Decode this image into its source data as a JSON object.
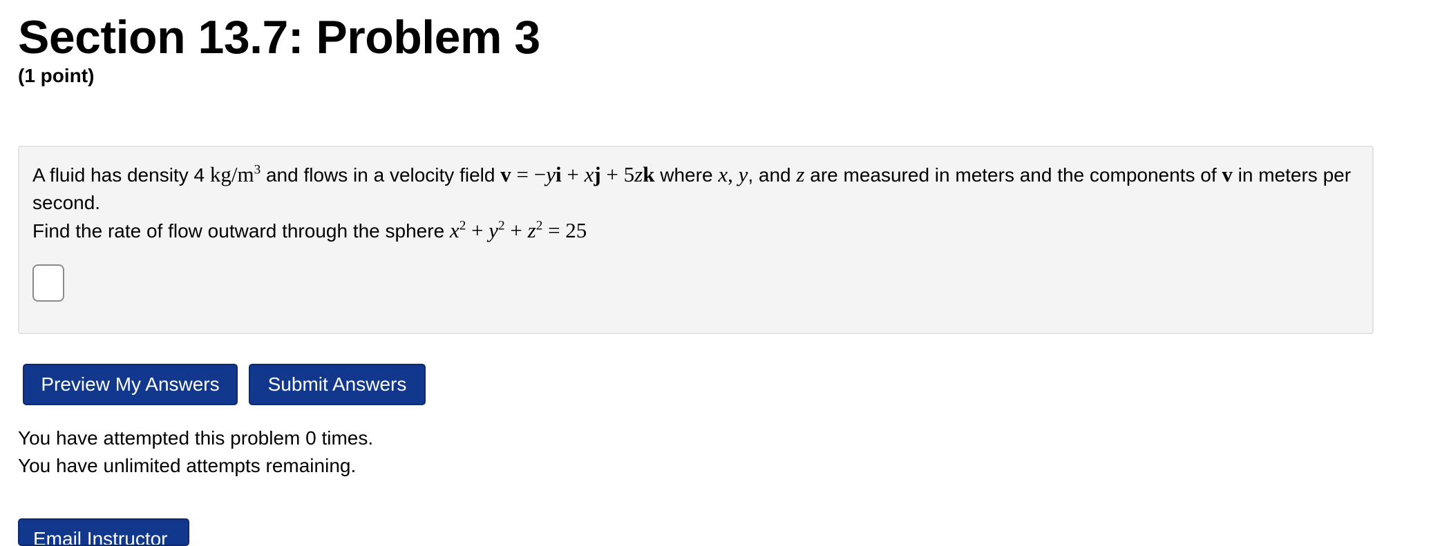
{
  "header": {
    "title": "Section 13.7: Problem 3",
    "points": "(1 point)"
  },
  "problem": {
    "line1_a": "A fluid has density 4 ",
    "density_unit": "kg/m",
    "density_exp": "3",
    "line1_b": " and flows in a velocity field ",
    "vec_v": "v",
    "field_eq": " = −",
    "var_y": "y",
    "unit_i": "i",
    "plus1": " + ",
    "var_x": "x",
    "unit_j": "j",
    "plus2": " + 5",
    "var_z": "z",
    "unit_k": "k",
    "line1_c": " where ",
    "coord_x": "x",
    "comma1": ", ",
    "coord_y": "y",
    "comma2": ", and ",
    "coord_z": "z",
    "line1_d": " are measured in meters and the components of ",
    "vec_v2": "v",
    "line1_e": " in meters per second.",
    "line2": "Find the rate of flow outward through the sphere ",
    "sph_x": "x",
    "sph_x_exp": "2",
    "sph_plus1": " + ",
    "sph_y": "y",
    "sph_y_exp": "2",
    "sph_plus2": " + ",
    "sph_z": "z",
    "sph_z_exp": "2",
    "sph_eq": " = 25",
    "answer_value": ""
  },
  "buttons": {
    "preview_label": "Preview My Answers",
    "submit_label": "Submit Answers",
    "email_label": "Email Instructor"
  },
  "status": {
    "attempted": "You have attempted this problem 0 times.",
    "remaining": "You have unlimited attempts remaining."
  }
}
